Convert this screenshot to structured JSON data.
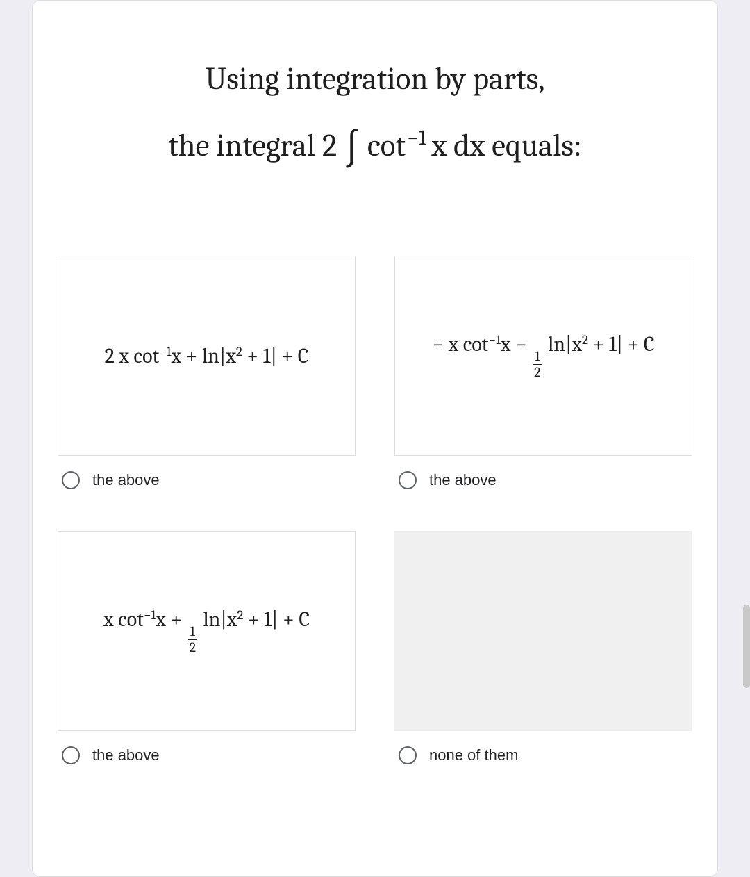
{
  "question": {
    "line1": "Using integration by parts,",
    "line2_prefix": "the integral  2 ",
    "line2_func": "cot",
    "line2_sup": "−1",
    "line2_var": " x dx ",
    "line2_suffix": " equals:"
  },
  "options": {
    "a": {
      "label": "the above",
      "expr_text": "2 x cot⁻¹x + ln|x² + 1| + C"
    },
    "b": {
      "label": "the above",
      "expr_text": "− x cot⁻¹x − ½ ln|x² + 1| + C"
    },
    "c": {
      "label": "the above",
      "expr_text": "x cot⁻¹x + ½ ln|x² + 1| + C"
    },
    "d": {
      "label": "none of them"
    }
  }
}
